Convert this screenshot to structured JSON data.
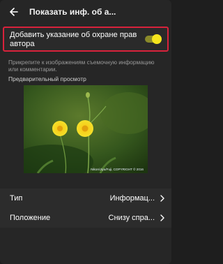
{
  "header": {
    "title": "Показать инф. об а..."
  },
  "setting": {
    "label": "Добавить указание об охране прав автора",
    "enabled": true,
    "accent_color": "#f5e51d",
    "border_color": "#d9223b"
  },
  "hint": "Прикрепите к изображениям съемочную информацию или комментарии.",
  "preview": {
    "section_label": "Предварительный просмотр",
    "watermark_text": "Nikon/Jiya/Fuji, COPYRIGHT © 2016"
  },
  "rows": [
    {
      "label": "Тип",
      "value": "Информац..."
    },
    {
      "label": "Положение",
      "value": "Снизу спра..."
    }
  ]
}
